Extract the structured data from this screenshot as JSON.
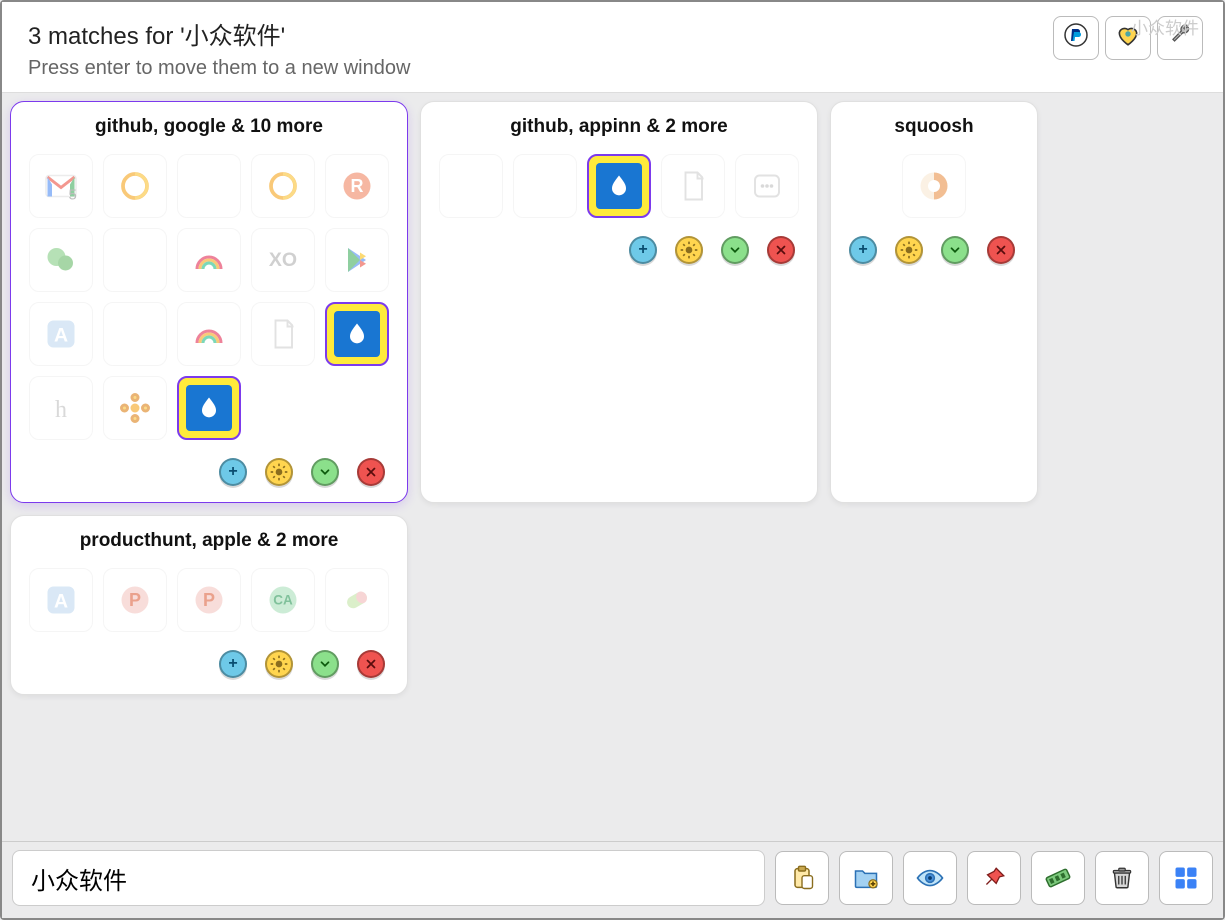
{
  "header": {
    "title": "3 matches for '小众软件'",
    "subtitle": "Press enter to move them to a new window",
    "watermark": "小众软件"
  },
  "header_buttons": {
    "donate": "paypal-icon",
    "favorite": "heart-icon",
    "settings": "wrench-icon"
  },
  "groups": [
    {
      "id": "g1",
      "title": "github, google & 10 more",
      "selected": true,
      "tabs": [
        {
          "icon": "gmail",
          "badge": "5"
        },
        {
          "icon": "swirl-orange"
        },
        {
          "icon": "blank"
        },
        {
          "icon": "swirl-orange"
        },
        {
          "icon": "r-circle"
        },
        {
          "icon": "wechat"
        },
        {
          "icon": "blank"
        },
        {
          "icon": "rainbow"
        },
        {
          "icon": "xo"
        },
        {
          "icon": "play-store"
        },
        {
          "icon": "appstore"
        },
        {
          "icon": "blank"
        },
        {
          "icon": "rainbow"
        },
        {
          "icon": "document"
        },
        {
          "icon": "drop",
          "highlight": true
        },
        {
          "icon": "h-circle"
        },
        {
          "icon": "flower"
        },
        {
          "icon": "drop",
          "highlight": true
        }
      ]
    },
    {
      "id": "g2",
      "title": "github, appinn & 2 more",
      "selected": false,
      "tabs": [
        {
          "icon": "blank"
        },
        {
          "icon": "blank"
        },
        {
          "icon": "drop",
          "highlight": true
        },
        {
          "icon": "document"
        },
        {
          "icon": "dots-box"
        }
      ]
    },
    {
      "id": "g3",
      "title": "squoosh",
      "selected": false,
      "single": true,
      "tabs": [
        {
          "icon": "squoosh"
        }
      ]
    },
    {
      "id": "g4",
      "title": "producthunt, apple & 2 more",
      "selected": false,
      "tabs": [
        {
          "icon": "appstore"
        },
        {
          "icon": "p-circle"
        },
        {
          "icon": "p-circle"
        },
        {
          "icon": "ca-circle"
        },
        {
          "icon": "pill"
        }
      ]
    }
  ],
  "group_actions": {
    "add": "+",
    "settings": "gear",
    "collapse": "V",
    "close": "×"
  },
  "footer": {
    "search_value": "小众软件",
    "buttons": {
      "paste": "clipboard-icon",
      "folder": "folder-icon",
      "eye": "eye-icon",
      "pin": "pin-icon",
      "ram": "ram-icon",
      "trash": "trash-icon",
      "grid": "grid-icon"
    }
  }
}
